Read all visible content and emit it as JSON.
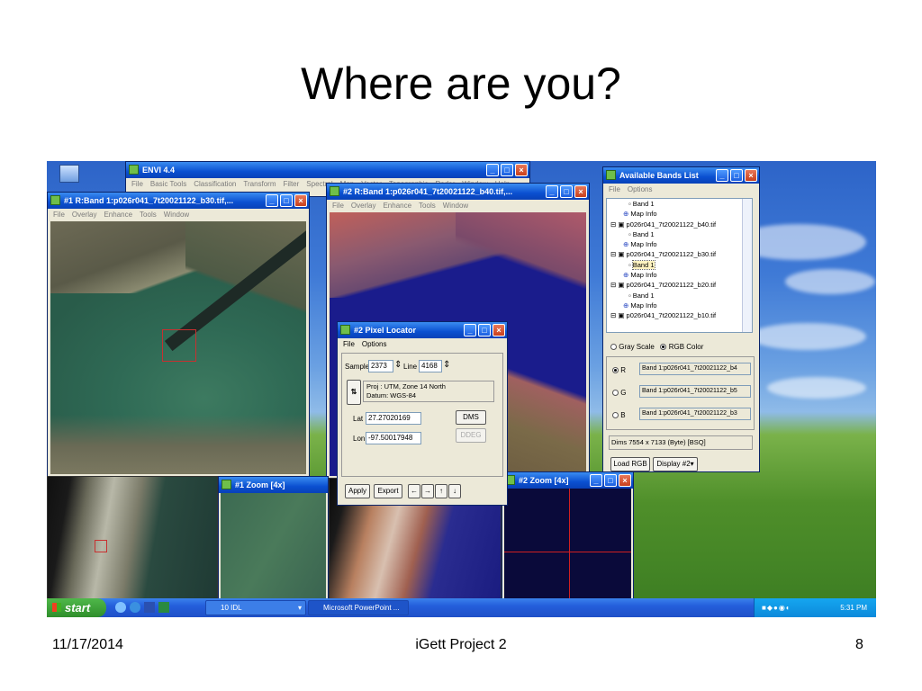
{
  "slide": {
    "title": "Where are you?",
    "footer_date": "11/17/2014",
    "footer_center": "iGett Project 2",
    "footer_page": "8"
  },
  "envi": {
    "title": "ENVI 4.4",
    "menu": [
      "File",
      "Basic Tools",
      "Classification",
      "Transform",
      "Filter",
      "Spectral",
      "Map",
      "Vector",
      "Topographic",
      "Radar",
      "Window",
      "Help"
    ]
  },
  "display1": {
    "title": "#1 R:Band 1:p026r041_7t20021122_b30.tif,...",
    "menu": [
      "File",
      "Overlay",
      "Enhance",
      "Tools",
      "Window"
    ]
  },
  "display2": {
    "title": "#2 R:Band 1:p026r041_7t20021122_b40.tif,...",
    "menu": [
      "File",
      "Overlay",
      "Enhance",
      "Tools",
      "Window"
    ]
  },
  "zoom1": {
    "title": "#1 Zoom [4x]"
  },
  "zoom2": {
    "title": "#2 Zoom [4x]"
  },
  "pixel_locator": {
    "title": "#2 Pixel Locator",
    "menu": [
      "File",
      "Options"
    ],
    "sample_label": "Sample",
    "sample_value": "2373",
    "line_label": "Line",
    "line_value": "4168",
    "proj_line1": "Proj : UTM, Zone 14 North",
    "proj_line2": "Datum: WGS-84",
    "lat_label": "Lat",
    "lat_value": "27.27020169",
    "lon_label": "Lon",
    "lon_value": "-97.50017948",
    "dms_button": "DMS",
    "ddeg_button": "DDEG",
    "apply_button": "Apply",
    "export_button": "Export",
    "arrows": [
      "←",
      "→",
      "↑",
      "↓"
    ]
  },
  "bands_list": {
    "title": "Available Bands List",
    "menu": [
      "File",
      "Options"
    ],
    "tree": [
      "Band 1",
      "Map Info",
      "p026r041_7t20021122_b40.tif",
      "Band 1",
      "Map Info",
      "p026r041_7t20021122_b30.tif",
      "Band 1",
      "Map Info",
      "p026r041_7t20021122_b20.tif",
      "Band 1",
      "Map Info",
      "p026r041_7t20021122_b10.tif"
    ],
    "gray_scale": "Gray Scale",
    "rgb_color": "RGB Color",
    "r_label": "R",
    "r_value": "Band 1:p026r041_7t20021122_b4",
    "g_label": "G",
    "g_value": "Band 1:p026r041_7t20021122_b5",
    "b_label": "B",
    "b_value": "Band 1:p026r041_7t20021122_b3",
    "dims_label": "Dims",
    "dims_value": "7554 x 7133 (Byte) [BSQ]",
    "load_rgb": "Load RGB",
    "display_select": "Display #2"
  },
  "taskbar": {
    "start": "start",
    "task1": "10 IDL",
    "task2": "Microsoft PowerPoint ...",
    "clock": "5:31 PM"
  }
}
